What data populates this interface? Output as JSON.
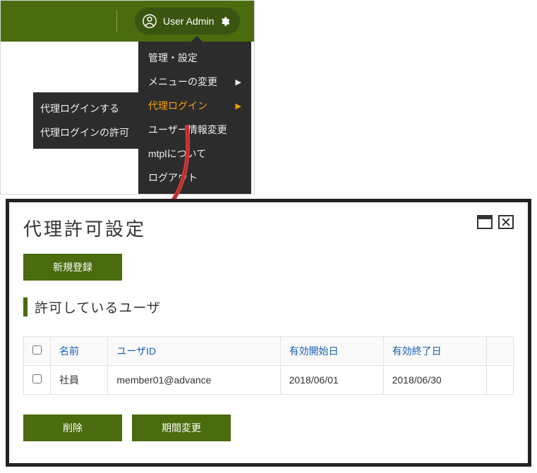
{
  "header": {
    "user_label": "User Admin"
  },
  "dropdown": {
    "items": [
      {
        "label": "管理・設定",
        "arrow": false,
        "active": false
      },
      {
        "label": "メニューの変更",
        "arrow": true,
        "active": false
      },
      {
        "label": "代理ログイン",
        "arrow": true,
        "active": true
      },
      {
        "label": "ユーザー情報変更",
        "arrow": false,
        "active": false
      },
      {
        "label": "mtplについて",
        "arrow": false,
        "active": false
      },
      {
        "label": "ログアウト",
        "arrow": false,
        "active": false
      }
    ]
  },
  "submenu": {
    "items": [
      {
        "label": "代理ログインする"
      },
      {
        "label": "代理ログインの許可"
      }
    ]
  },
  "panel": {
    "title": "代理許可設定",
    "new_button": "新規登録",
    "section_heading": "許可しているユーザ",
    "columns": {
      "name": "名前",
      "user_id": "ユーザID",
      "start": "有効開始日",
      "end": "有効終了日"
    },
    "rows": [
      {
        "name": "社員",
        "user_id": "member01@advance",
        "start": "2018/06/01",
        "end": "2018/06/30"
      }
    ],
    "delete_button": "削除",
    "period_button": "期間変更"
  }
}
